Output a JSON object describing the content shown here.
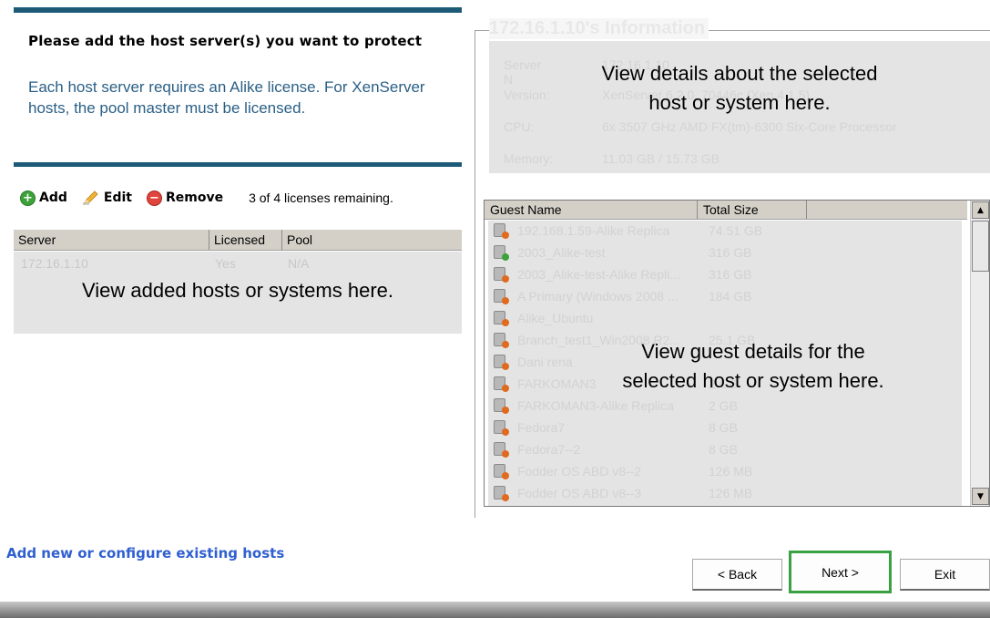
{
  "hosts_panel": {
    "heading": "Please add the host server(s) you want to protect",
    "subtext": "Each host server requires an Alike license.  For XenServer hosts, the pool master must be licensed.",
    "toolbar": {
      "add_label": "Add",
      "edit_label": "Edit",
      "remove_label": "Remove",
      "licenses_remaining": "3 of 4 licenses remaining."
    },
    "columns": [
      "Server",
      "Licensed",
      "Pool"
    ],
    "rows": [
      {
        "server": "172.16.1.10",
        "licensed": "Yes",
        "pool": "N/A"
      }
    ],
    "overlay_note": "View added hosts or systems here."
  },
  "info_panel": {
    "title": "172.16.1.10's Information",
    "fields": [
      {
        "label": "Server N",
        "value": "172.16.1.10"
      },
      {
        "label": "Version:",
        "value": "XenServer 6.2.0, 70446c (Xen 4.1.5)"
      },
      {
        "label": "CPU:",
        "value": "6x 3507 GHz AMD FX(tm)-6300 Six-Core Processor"
      },
      {
        "label": "Memory:",
        "value": "11.03 GB / 15.73 GB"
      }
    ],
    "overlay_note_line1": "View details about the selected",
    "overlay_note_line2": "host or system here."
  },
  "guest_list": {
    "columns": [
      "Guest Name",
      "Total Size"
    ],
    "rows": [
      {
        "name": "192.168.1.59-Alike Replica",
        "size": "74.51 GB",
        "icon": "vm-icon",
        "status_color": "#e06a1e"
      },
      {
        "name": "2003_Alike-test",
        "size": "316 GB",
        "icon": "vm-icon",
        "status_color": "#3aa33a"
      },
      {
        "name": "2003_Alike-test-Alike Repli...",
        "size": "316 GB",
        "icon": "vm-icon",
        "status_color": "#e06a1e"
      },
      {
        "name": "A Primary (Windows 2008 ...",
        "size": "184 GB",
        "icon": "vm-icon",
        "status_color": "#e06a1e"
      },
      {
        "name": "Alike_Ubuntu",
        "size": "",
        "icon": "vm-icon",
        "status_color": "#e06a1e"
      },
      {
        "name": "Branch_test1_Win2008 R2...",
        "size": "25.1 GB",
        "icon": "vm-icon",
        "status_color": "#e06a1e"
      },
      {
        "name": "Dani rena",
        "size": "",
        "icon": "vm-icon",
        "status_color": "#e06a1e"
      },
      {
        "name": "FARKOMAN3",
        "size": "2 GB",
        "icon": "vm-icon",
        "status_color": "#e06a1e"
      },
      {
        "name": "FARKOMAN3-Alike Replica",
        "size": "2 GB",
        "icon": "vm-icon",
        "status_color": "#e06a1e"
      },
      {
        "name": "Fedora7",
        "size": "8 GB",
        "icon": "vm-icon",
        "status_color": "#e06a1e"
      },
      {
        "name": "Fedora7--2",
        "size": "8 GB",
        "icon": "vm-icon",
        "status_color": "#e06a1e"
      },
      {
        "name": "Fodder OS ABD v8--2",
        "size": "126 MB",
        "icon": "vm-icon",
        "status_color": "#e06a1e"
      },
      {
        "name": "Fodder OS ABD v8--3",
        "size": "126 MB",
        "icon": "vm-icon",
        "status_color": "#e06a1e"
      }
    ],
    "overlay_note_line1": "View guest details for the",
    "overlay_note_line2": "selected host or system here."
  },
  "footer": {
    "link_text": "Add new or configure existing hosts",
    "back_label": "< Back",
    "next_label": "Next >",
    "exit_label": "Exit",
    "highlight_color": "#3aa142"
  }
}
